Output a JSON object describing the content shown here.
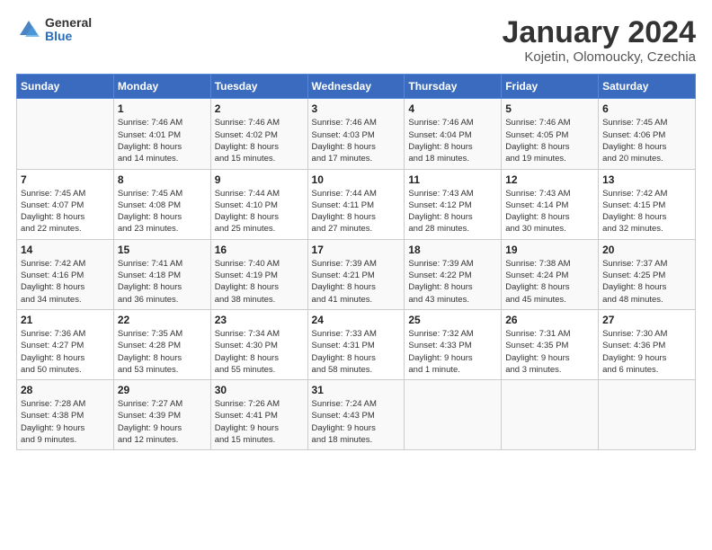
{
  "logo": {
    "general": "General",
    "blue": "Blue"
  },
  "title": "January 2024",
  "subtitle": "Kojetin, Olomoucky, Czechia",
  "days_header": [
    "Sunday",
    "Monday",
    "Tuesday",
    "Wednesday",
    "Thursday",
    "Friday",
    "Saturday"
  ],
  "weeks": [
    [
      {
        "num": "",
        "info": ""
      },
      {
        "num": "1",
        "info": "Sunrise: 7:46 AM\nSunset: 4:01 PM\nDaylight: 8 hours\nand 14 minutes."
      },
      {
        "num": "2",
        "info": "Sunrise: 7:46 AM\nSunset: 4:02 PM\nDaylight: 8 hours\nand 15 minutes."
      },
      {
        "num": "3",
        "info": "Sunrise: 7:46 AM\nSunset: 4:03 PM\nDaylight: 8 hours\nand 17 minutes."
      },
      {
        "num": "4",
        "info": "Sunrise: 7:46 AM\nSunset: 4:04 PM\nDaylight: 8 hours\nand 18 minutes."
      },
      {
        "num": "5",
        "info": "Sunrise: 7:46 AM\nSunset: 4:05 PM\nDaylight: 8 hours\nand 19 minutes."
      },
      {
        "num": "6",
        "info": "Sunrise: 7:45 AM\nSunset: 4:06 PM\nDaylight: 8 hours\nand 20 minutes."
      }
    ],
    [
      {
        "num": "7",
        "info": "Sunrise: 7:45 AM\nSunset: 4:07 PM\nDaylight: 8 hours\nand 22 minutes."
      },
      {
        "num": "8",
        "info": "Sunrise: 7:45 AM\nSunset: 4:08 PM\nDaylight: 8 hours\nand 23 minutes."
      },
      {
        "num": "9",
        "info": "Sunrise: 7:44 AM\nSunset: 4:10 PM\nDaylight: 8 hours\nand 25 minutes."
      },
      {
        "num": "10",
        "info": "Sunrise: 7:44 AM\nSunset: 4:11 PM\nDaylight: 8 hours\nand 27 minutes."
      },
      {
        "num": "11",
        "info": "Sunrise: 7:43 AM\nSunset: 4:12 PM\nDaylight: 8 hours\nand 28 minutes."
      },
      {
        "num": "12",
        "info": "Sunrise: 7:43 AM\nSunset: 4:14 PM\nDaylight: 8 hours\nand 30 minutes."
      },
      {
        "num": "13",
        "info": "Sunrise: 7:42 AM\nSunset: 4:15 PM\nDaylight: 8 hours\nand 32 minutes."
      }
    ],
    [
      {
        "num": "14",
        "info": "Sunrise: 7:42 AM\nSunset: 4:16 PM\nDaylight: 8 hours\nand 34 minutes."
      },
      {
        "num": "15",
        "info": "Sunrise: 7:41 AM\nSunset: 4:18 PM\nDaylight: 8 hours\nand 36 minutes."
      },
      {
        "num": "16",
        "info": "Sunrise: 7:40 AM\nSunset: 4:19 PM\nDaylight: 8 hours\nand 38 minutes."
      },
      {
        "num": "17",
        "info": "Sunrise: 7:39 AM\nSunset: 4:21 PM\nDaylight: 8 hours\nand 41 minutes."
      },
      {
        "num": "18",
        "info": "Sunrise: 7:39 AM\nSunset: 4:22 PM\nDaylight: 8 hours\nand 43 minutes."
      },
      {
        "num": "19",
        "info": "Sunrise: 7:38 AM\nSunset: 4:24 PM\nDaylight: 8 hours\nand 45 minutes."
      },
      {
        "num": "20",
        "info": "Sunrise: 7:37 AM\nSunset: 4:25 PM\nDaylight: 8 hours\nand 48 minutes."
      }
    ],
    [
      {
        "num": "21",
        "info": "Sunrise: 7:36 AM\nSunset: 4:27 PM\nDaylight: 8 hours\nand 50 minutes."
      },
      {
        "num": "22",
        "info": "Sunrise: 7:35 AM\nSunset: 4:28 PM\nDaylight: 8 hours\nand 53 minutes."
      },
      {
        "num": "23",
        "info": "Sunrise: 7:34 AM\nSunset: 4:30 PM\nDaylight: 8 hours\nand 55 minutes."
      },
      {
        "num": "24",
        "info": "Sunrise: 7:33 AM\nSunset: 4:31 PM\nDaylight: 8 hours\nand 58 minutes."
      },
      {
        "num": "25",
        "info": "Sunrise: 7:32 AM\nSunset: 4:33 PM\nDaylight: 9 hours\nand 1 minute."
      },
      {
        "num": "26",
        "info": "Sunrise: 7:31 AM\nSunset: 4:35 PM\nDaylight: 9 hours\nand 3 minutes."
      },
      {
        "num": "27",
        "info": "Sunrise: 7:30 AM\nSunset: 4:36 PM\nDaylight: 9 hours\nand 6 minutes."
      }
    ],
    [
      {
        "num": "28",
        "info": "Sunrise: 7:28 AM\nSunset: 4:38 PM\nDaylight: 9 hours\nand 9 minutes."
      },
      {
        "num": "29",
        "info": "Sunrise: 7:27 AM\nSunset: 4:39 PM\nDaylight: 9 hours\nand 12 minutes."
      },
      {
        "num": "30",
        "info": "Sunrise: 7:26 AM\nSunset: 4:41 PM\nDaylight: 9 hours\nand 15 minutes."
      },
      {
        "num": "31",
        "info": "Sunrise: 7:24 AM\nSunset: 4:43 PM\nDaylight: 9 hours\nand 18 minutes."
      },
      {
        "num": "",
        "info": ""
      },
      {
        "num": "",
        "info": ""
      },
      {
        "num": "",
        "info": ""
      }
    ]
  ]
}
